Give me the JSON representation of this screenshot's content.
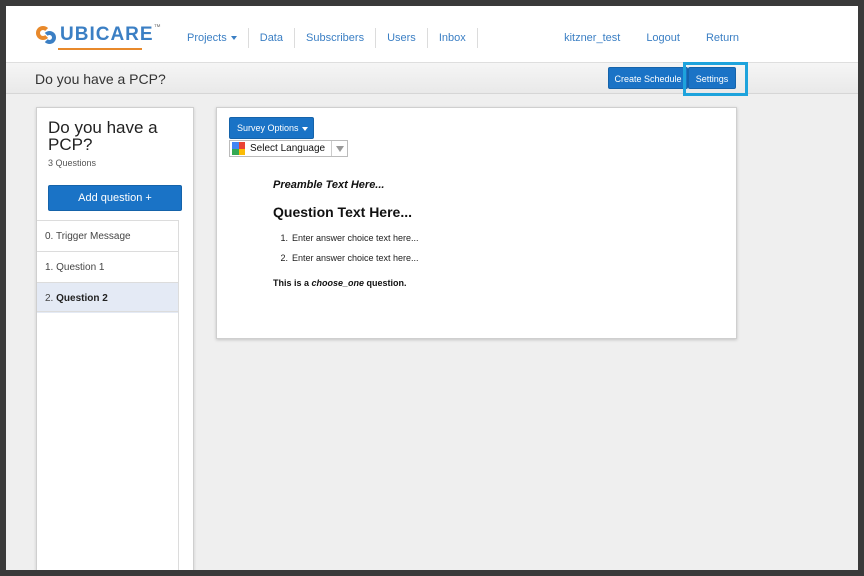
{
  "brand": {
    "name": "UBICARE",
    "tm": "™"
  },
  "nav": {
    "left": [
      "Projects",
      "Data",
      "Subscribers",
      "Users",
      "Inbox"
    ],
    "right": [
      "kitzner_test",
      "Logout",
      "Return"
    ]
  },
  "subheader": {
    "title": "Do you have a PCP?",
    "create_schedule": "Create Schedule",
    "settings": "Settings"
  },
  "sidebar": {
    "survey_title": "Do you have a PCP?",
    "question_count": "3 Questions",
    "add_question": "Add question +",
    "questions": [
      {
        "num": "0.",
        "name": "Trigger Message"
      },
      {
        "num": "1.",
        "name": "Question 1"
      },
      {
        "num": "2.",
        "name": "Question 2"
      }
    ],
    "active_index": 2
  },
  "preview": {
    "survey_options": "Survey Options",
    "language_label": "Select Language",
    "preamble": "Preamble Text Here...",
    "question": "Question Text Here...",
    "choices": [
      {
        "num": "1.",
        "text": "Enter answer choice text here..."
      },
      {
        "num": "2.",
        "text": "Enter answer choice text here..."
      }
    ],
    "type_prefix": "This is a ",
    "type_name": "choose_one",
    "type_suffix": " question."
  },
  "colors": {
    "brand_blue": "#3b7fc4",
    "brand_orange": "#e8892b",
    "button_blue": "#1a73c6",
    "highlight": "#1ea3dc"
  }
}
